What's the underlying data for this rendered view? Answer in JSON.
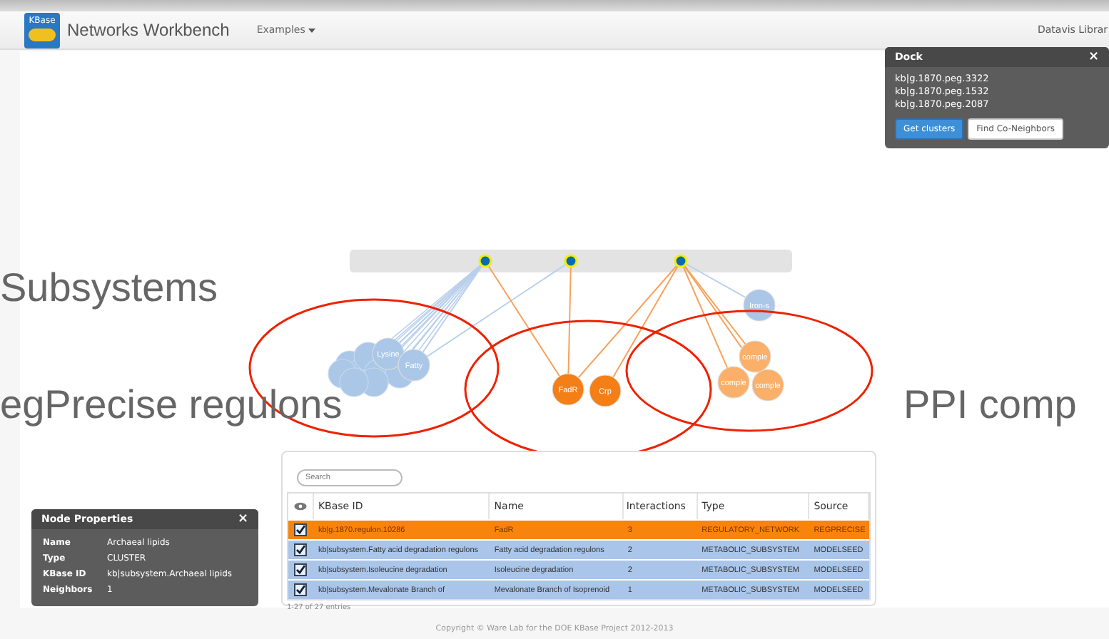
{
  "navbar": {
    "logo": "KBase",
    "title": "Networks Workbench",
    "menu": "Examples",
    "right_link": "Datavis Librar"
  },
  "annotations": [
    "Subsystems",
    "egPrecise regulons",
    "PPI comp"
  ],
  "graph": {
    "nodes": [
      {
        "label": "Lysine",
        "color": "#aac7e8"
      },
      {
        "label": "Fatty",
        "color": "#aac7e8"
      },
      {
        "label": "Iron-s",
        "color": "#aac7e8"
      },
      {
        "label": "FadR",
        "color": "#f57f17"
      },
      {
        "label": "Crp",
        "color": "#f57f17"
      },
      {
        "label": "comple",
        "color": "#fbb06a"
      },
      {
        "label": "comple",
        "color": "#fbb06a"
      },
      {
        "label": "comple",
        "color": "#fbb06a"
      }
    ]
  },
  "dock": {
    "title": "Dock",
    "close": "×",
    "items": [
      "kb|g.1870.peg.3322",
      "kb|g.1870.peg.1532",
      "kb|g.1870.peg.2087"
    ],
    "buttons": [
      {
        "label": "Get clusters",
        "kind": "primary"
      },
      {
        "label": "Find Co-Neighbors",
        "kind": "default"
      }
    ]
  },
  "table": {
    "search": {
      "placeholder": "Search"
    },
    "columns": [
      "KBase ID",
      "Name",
      "Interactions",
      "Type",
      "Source"
    ],
    "rows": [
      {
        "checked": true,
        "selected": true,
        "cells": [
          "kb|g.1870.regulon.10286",
          "FadR",
          "3",
          "REGULATORY_NETWORK",
          "REGPRECISE"
        ]
      },
      {
        "checked": true,
        "selected": false,
        "cells": [
          "kb|subsystem.Fatty acid degradation regulons",
          "Fatty acid degradation regulons",
          "2",
          "METABOLIC_SUBSYSTEM",
          "MODELSEED"
        ]
      },
      {
        "checked": true,
        "selected": false,
        "cells": [
          "kb|subsystem.Isoleucine degradation",
          "Isoleucine degradation",
          "2",
          "METABOLIC_SUBSYSTEM",
          "MODELSEED"
        ]
      },
      {
        "checked": true,
        "selected": false,
        "cells": [
          "kb|subsystem.Mevalonate Branch of",
          "Mevalonate Branch of Isoprenoid",
          "1",
          "METABOLIC_SUBSYSTEM",
          "MODELSEED"
        ]
      }
    ],
    "info": "1-27 of 27 entries"
  },
  "node_properties": {
    "title": "Node Properties",
    "close": "×",
    "rows": [
      {
        "key": "Name",
        "value": "Archaeal lipids"
      },
      {
        "key": "Type",
        "value": "CLUSTER"
      },
      {
        "key": "KBase ID",
        "value": "kb|subsystem.Archaeal lipids"
      },
      {
        "key": "Neighbors",
        "value": "1"
      }
    ]
  },
  "footer": "Copyright © Ware Lab for the DOE KBase Project 2012-2013"
}
